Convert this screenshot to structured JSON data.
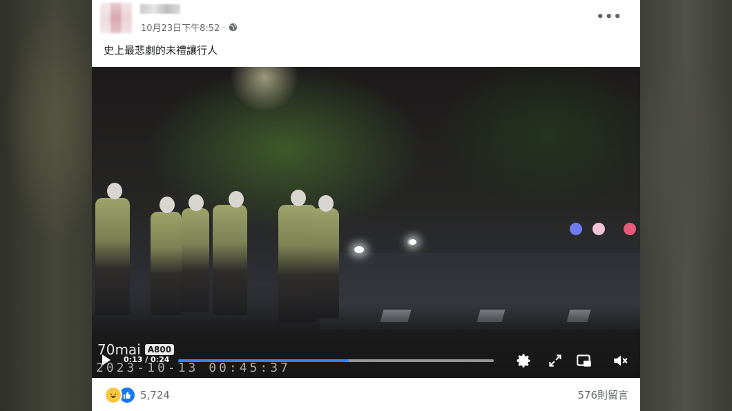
{
  "post": {
    "author": "",
    "timestamp": "10月23日下午8:52 ·",
    "privacy_icon": "globe-icon",
    "more_icon": "•••",
    "caption": "史上最悲劇的未禮讓行人"
  },
  "video": {
    "overlay_brand": "70mai",
    "overlay_model": "A800",
    "overlay_timestamp": "2023-10-13 00:45:37",
    "current_time": "0:13",
    "duration": "0:24",
    "time_display": "0:13 / 0:24",
    "progress_fraction": 0.54,
    "progress_color": "#2d88ff",
    "controls": [
      "play-icon",
      "gear-icon",
      "fullscreen-icon",
      "picture-in-picture-icon",
      "muted-speaker-icon"
    ]
  },
  "footer": {
    "reaction_icons": [
      "haha-icon",
      "like-icon"
    ],
    "reaction_count": "5,724",
    "comments": "576則留言"
  },
  "colors": {
    "accent": "#1877f2",
    "text_secondary": "#65676b"
  }
}
